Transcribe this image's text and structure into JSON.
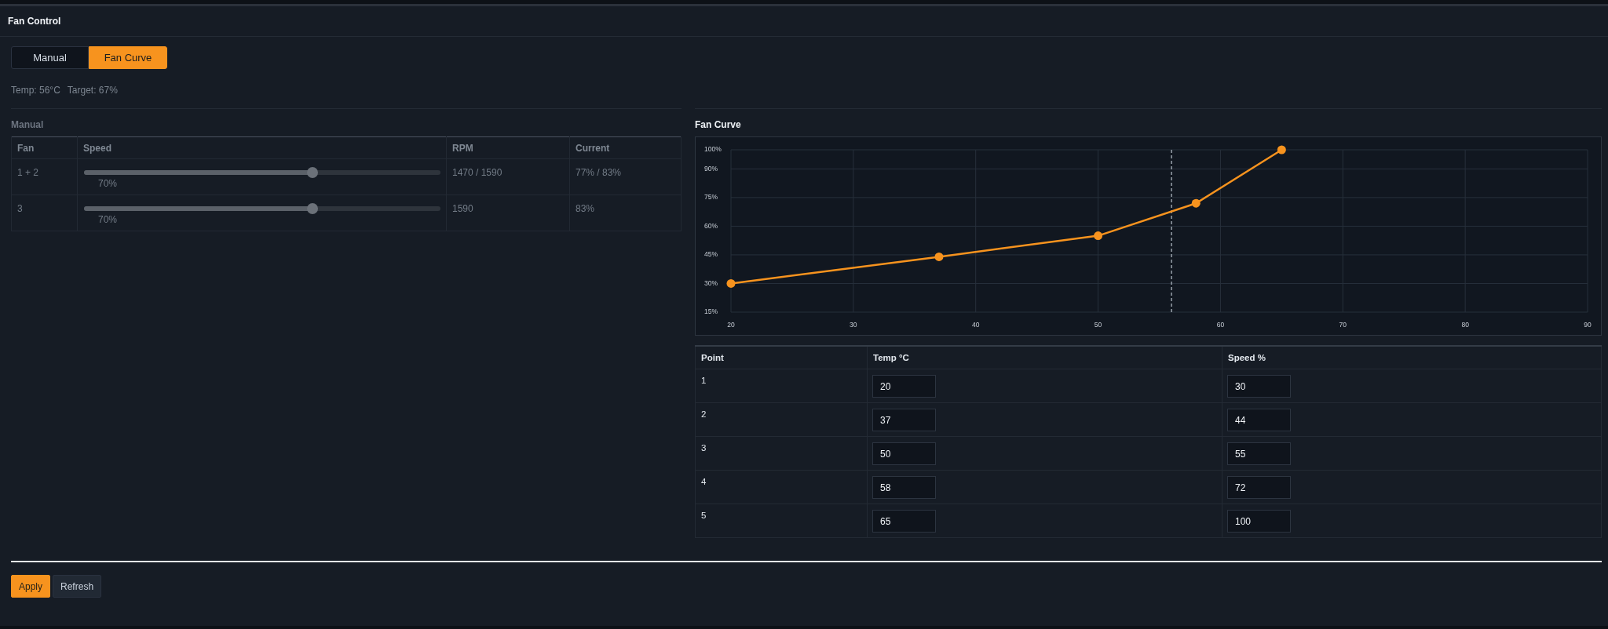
{
  "header": {
    "title": "Fan Control"
  },
  "tabs": [
    {
      "label": "Manual",
      "selected": false
    },
    {
      "label": "Fan Curve",
      "selected": true
    }
  ],
  "status": {
    "temp": "Temp: 56°C",
    "target": "Target: 67%"
  },
  "manual": {
    "title": "Manual",
    "columns": [
      "Fan",
      "Speed",
      "RPM",
      "Current"
    ],
    "rows": [
      {
        "fan": "1 + 2",
        "speed": {
          "level": 0.64,
          "reading": "70%"
        },
        "rpm": "1470 / 1590",
        "current": "77% / 83%"
      },
      {
        "fan": "3",
        "speed": {
          "level": 0.64,
          "reading": "70%"
        },
        "rpm": "1590",
        "current": "83%"
      }
    ]
  },
  "curve": {
    "chart_data": {
      "type": "line",
      "title": "Fan Curve",
      "x": [
        20,
        37,
        50,
        58,
        65
      ],
      "series": [
        {
          "color": "#f7931e",
          "marker": "circle",
          "values": [
            30,
            44,
            55,
            72,
            100
          ]
        }
      ],
      "xlim": [
        20,
        90
      ],
      "ylim": [
        15,
        100
      ],
      "xticks": [
        20,
        30,
        40,
        50,
        60,
        70,
        80,
        90
      ],
      "yticks": [
        {
          "value": 15,
          "label": "15%"
        },
        {
          "value": 30,
          "label": "30%"
        },
        {
          "value": 45,
          "label": "45%"
        },
        {
          "value": 60,
          "label": "60%"
        },
        {
          "value": 75,
          "label": "75%"
        },
        {
          "value": 90,
          "label": "90%"
        },
        {
          "value": 100,
          "label": "100%"
        }
      ],
      "grid": true,
      "ref_lines": [
        {
          "axis": "x",
          "value": 56
        }
      ]
    },
    "points": {
      "columns": [
        "Point",
        "Temp °C",
        "Speed %"
      ],
      "rows": [
        {
          "point": "1",
          "temp": "20",
          "speed": "30"
        },
        {
          "point": "2",
          "temp": "37",
          "speed": "44"
        },
        {
          "point": "3",
          "temp": "50",
          "speed": "55"
        },
        {
          "point": "4",
          "temp": "58",
          "speed": "72"
        },
        {
          "point": "5",
          "temp": "65",
          "speed": "100"
        }
      ]
    }
  },
  "buttons": [
    {
      "label": "Apply",
      "kind": "primary"
    },
    {
      "label": "Refresh",
      "kind": "secondary"
    }
  ]
}
